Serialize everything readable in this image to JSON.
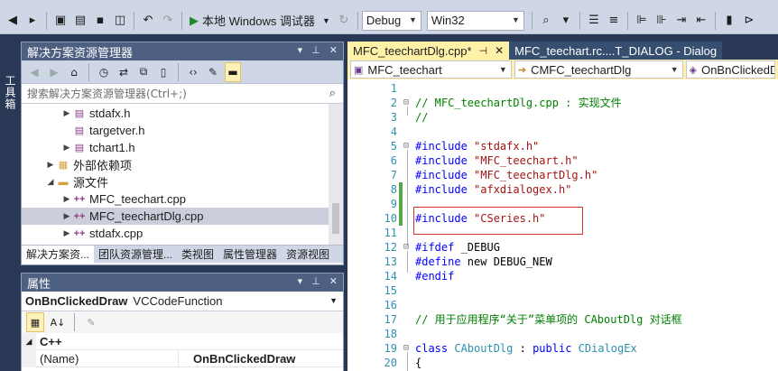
{
  "toolbar": {
    "run_label": "本地 Windows 调试器",
    "config_value": "Debug",
    "platform_value": "Win32"
  },
  "toolbox": {
    "label": "工具箱"
  },
  "solution_explorer": {
    "title": "解决方案资源管理器",
    "search_placeholder": "搜索解决方案资源管理器(Ctrl+;)",
    "tree": [
      {
        "label": "stdafx.h",
        "icon": "header-file-icon"
      },
      {
        "label": "targetver.h",
        "icon": "header-file-icon"
      },
      {
        "label": "tchart1.h",
        "icon": "header-file-icon"
      },
      {
        "label": "外部依赖项",
        "icon": "external-deps-icon"
      },
      {
        "label": "源文件",
        "icon": "folder-icon"
      },
      {
        "label": "MFC_teechart.cpp",
        "icon": "cpp-file-icon"
      },
      {
        "label": "MFC_teechartDlg.cpp",
        "icon": "cpp-file-icon",
        "selected": true
      },
      {
        "label": "stdafx.cpp",
        "icon": "cpp-file-icon"
      }
    ],
    "tabs": [
      "解决方案资...",
      "团队资源管理...",
      "类视图",
      "属性管理器",
      "资源视图"
    ]
  },
  "properties": {
    "title": "属性",
    "object_name": "OnBnClickedDraw",
    "object_type": "VCCodeFunction",
    "category": "C++",
    "rows": [
      {
        "name": "(Name)",
        "value": "OnBnClickedDraw"
      }
    ]
  },
  "editor": {
    "tabs": [
      {
        "label": "MFC_teechartDlg.cpp*",
        "active": true
      },
      {
        "label": "MFC_teechart.rc....T_DIALOG - Dialog",
        "active": false
      }
    ],
    "nav": {
      "project": "MFC_teechart",
      "class": "CMFC_teechartDlg",
      "member": "OnBnClickedDr"
    },
    "lines": [
      {
        "n": "1",
        "parts": []
      },
      {
        "n": "2",
        "fold": "⊟",
        "parts": [
          {
            "t": "// MFC_teechartDlg.cpp : 实现文件",
            "c": "c-comment"
          }
        ]
      },
      {
        "n": "3",
        "parts": [
          {
            "t": "//",
            "c": "c-comment"
          }
        ]
      },
      {
        "n": "4",
        "parts": []
      },
      {
        "n": "5",
        "fold": "⊟",
        "parts": [
          {
            "t": "#include ",
            "c": "c-kw"
          },
          {
            "t": "\"stdafx.h\"",
            "c": "c-str"
          }
        ]
      },
      {
        "n": "6",
        "parts": [
          {
            "t": "#include ",
            "c": "c-kw"
          },
          {
            "t": "\"MFC_teechart.h\"",
            "c": "c-str"
          }
        ]
      },
      {
        "n": "7",
        "parts": [
          {
            "t": "#include ",
            "c": "c-kw"
          },
          {
            "t": "\"MFC_teechartDlg.h\"",
            "c": "c-str"
          }
        ]
      },
      {
        "n": "8",
        "mod": true,
        "parts": [
          {
            "t": "#include ",
            "c": "c-kw"
          },
          {
            "t": "\"afxdialogex.h\"",
            "c": "c-str"
          }
        ]
      },
      {
        "n": "9",
        "mod": true,
        "parts": []
      },
      {
        "n": "10",
        "mod": true,
        "parts": [
          {
            "t": "#include ",
            "c": "c-kw"
          },
          {
            "t": "\"CSeries.h\"",
            "c": "c-str"
          }
        ]
      },
      {
        "n": "11",
        "parts": []
      },
      {
        "n": "12",
        "fold": "⊟",
        "parts": [
          {
            "t": "#ifdef ",
            "c": "c-kw"
          },
          {
            "t": "_DEBUG",
            "c": ""
          }
        ]
      },
      {
        "n": "13",
        "parts": [
          {
            "t": "#define ",
            "c": "c-kw"
          },
          {
            "t": "new DEBUG_NEW",
            "c": ""
          }
        ]
      },
      {
        "n": "14",
        "parts": [
          {
            "t": "#endif",
            "c": "c-kw"
          }
        ]
      },
      {
        "n": "15",
        "parts": []
      },
      {
        "n": "16",
        "parts": []
      },
      {
        "n": "17",
        "parts": [
          {
            "t": "// 用于应用程序“关于”菜单项的 CAboutDlg 对话框",
            "c": "c-comment"
          }
        ]
      },
      {
        "n": "18",
        "parts": []
      },
      {
        "n": "19",
        "fold": "⊟",
        "parts": [
          {
            "t": "class ",
            "c": "c-kw"
          },
          {
            "t": "CAboutDlg",
            "c": "c-type"
          },
          {
            "t": " : ",
            "c": ""
          },
          {
            "t": "public ",
            "c": "c-kw"
          },
          {
            "t": "CDialogEx",
            "c": "c-type"
          }
        ]
      },
      {
        "n": "20",
        "parts": [
          {
            "t": "{",
            "c": ""
          }
        ]
      }
    ]
  },
  "colors": {
    "ide_frame": "#293955",
    "active_tab": "#fff1a8",
    "highlight_box": "#e0322e",
    "modified_bar": "#57a64a"
  }
}
